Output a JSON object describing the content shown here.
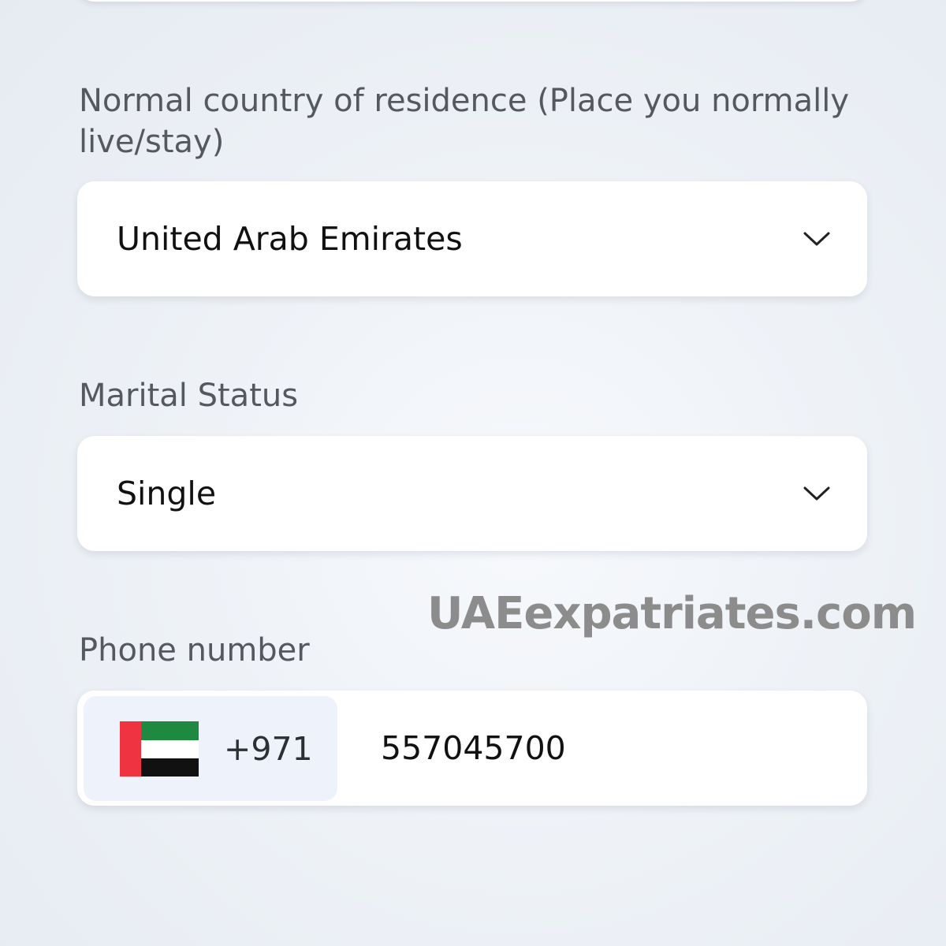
{
  "form": {
    "residence": {
      "label": "Normal country of residence (Place you normally live/stay)",
      "selected_value": "United Arab Emirates",
      "icon": "chevron-down-icon"
    },
    "marital_status": {
      "label": "Marital Status",
      "selected_value": "Single",
      "icon": "chevron-down-icon"
    },
    "phone": {
      "label": "Phone number",
      "country_flag": "uae-flag-icon",
      "dial_code": "+971",
      "value": "557045700"
    }
  },
  "watermark": {
    "text": "UAEexpatriates.com",
    "color": "#8c8c8c"
  },
  "colors": {
    "label_text": "#55595f",
    "field_background": "#ffffff",
    "country_picker_background": "#eef3fb",
    "flag_red": "#ef3340",
    "flag_green": "#1e8a3f",
    "flag_white": "#ffffff",
    "flag_black": "#111111"
  }
}
